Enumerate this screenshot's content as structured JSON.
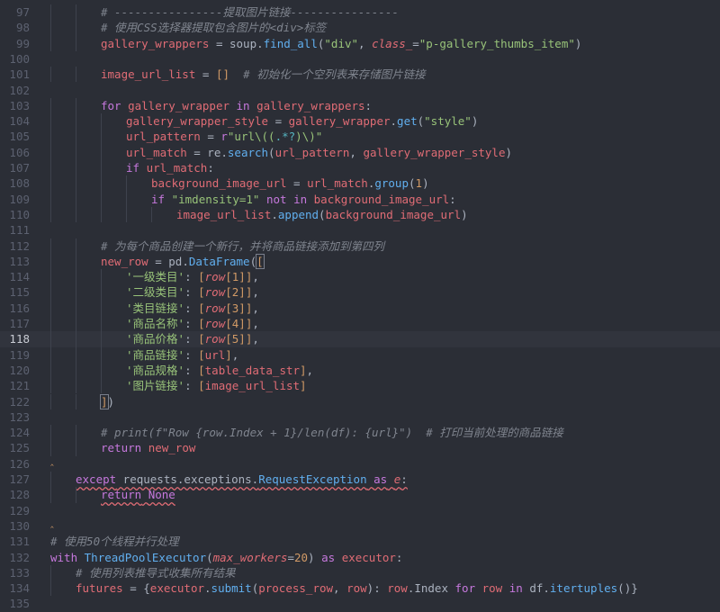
{
  "colors": {
    "background": "#2b2e36",
    "active_line": "#31343d",
    "keyword": "#c678dd",
    "builtin": "#61afef",
    "string": "#98c379",
    "param": "#e06c75",
    "number": "#d19a66",
    "comment": "#7f848e",
    "text": "#abb2bf",
    "escape": "#56b6c2"
  },
  "active_line": 118,
  "lines": [
    {
      "n": "97",
      "indent": 2,
      "segs": [
        [
          "c",
          "# ----------------提取图片链接----------------"
        ]
      ]
    },
    {
      "n": "98",
      "indent": 2,
      "segs": [
        [
          "c",
          "# 使用CSS选择器提取包含图片的<div>标签"
        ]
      ]
    },
    {
      "n": "99",
      "indent": 2,
      "segs": [
        [
          "v",
          "gallery_wrappers"
        ],
        [
          "t",
          " = soup."
        ],
        [
          "f",
          "find_all"
        ],
        [
          "t",
          "("
        ],
        [
          "s",
          "\"div\""
        ],
        [
          "t",
          ", "
        ],
        [
          "pi",
          "class_"
        ],
        [
          "t",
          "="
        ],
        [
          "s",
          "\"p-gallery_thumbs_item\""
        ],
        [
          "t",
          ")"
        ]
      ]
    },
    {
      "n": "100",
      "indent": 0,
      "segs": []
    },
    {
      "n": "101",
      "indent": 2,
      "segs": [
        [
          "v",
          "image_url_list"
        ],
        [
          "t",
          " = "
        ],
        [
          "y",
          "[]"
        ],
        [
          "t",
          "  "
        ],
        [
          "c",
          "# 初始化一个空列表来存储图片链接"
        ]
      ]
    },
    {
      "n": "102",
      "indent": 0,
      "segs": []
    },
    {
      "n": "103",
      "indent": 2,
      "segs": [
        [
          "k",
          "for"
        ],
        [
          "t",
          " "
        ],
        [
          "v",
          "gallery_wrapper"
        ],
        [
          "t",
          " "
        ],
        [
          "k",
          "in"
        ],
        [
          "t",
          " "
        ],
        [
          "v",
          "gallery_wrappers"
        ],
        [
          "t",
          ":"
        ]
      ]
    },
    {
      "n": "104",
      "indent": 3,
      "segs": [
        [
          "v",
          "gallery_wrapper_style"
        ],
        [
          "t",
          " = "
        ],
        [
          "v",
          "gallery_wrapper"
        ],
        [
          "t",
          "."
        ],
        [
          "f",
          "get"
        ],
        [
          "t",
          "("
        ],
        [
          "s",
          "\"style\""
        ],
        [
          "t",
          ")"
        ]
      ]
    },
    {
      "n": "105",
      "indent": 3,
      "segs": [
        [
          "v",
          "url_pattern"
        ],
        [
          "t",
          " = "
        ],
        [
          "k",
          "r"
        ],
        [
          "s",
          "\"url\\(("
        ],
        [
          "e",
          ".*?"
        ],
        [
          "s",
          ")\\)\""
        ]
      ]
    },
    {
      "n": "106",
      "indent": 3,
      "segs": [
        [
          "v",
          "url_match"
        ],
        [
          "t",
          " = re."
        ],
        [
          "f",
          "search"
        ],
        [
          "t",
          "("
        ],
        [
          "v",
          "url_pattern"
        ],
        [
          "t",
          ", "
        ],
        [
          "v",
          "gallery_wrapper_style"
        ],
        [
          "t",
          ")"
        ]
      ]
    },
    {
      "n": "107",
      "indent": 3,
      "segs": [
        [
          "k",
          "if"
        ],
        [
          "t",
          " "
        ],
        [
          "v",
          "url_match"
        ],
        [
          "t",
          ":"
        ]
      ]
    },
    {
      "n": "108",
      "indent": 4,
      "segs": [
        [
          "v",
          "background_image_url"
        ],
        [
          "t",
          " = "
        ],
        [
          "v",
          "url_match"
        ],
        [
          "t",
          "."
        ],
        [
          "f",
          "group"
        ],
        [
          "t",
          "("
        ],
        [
          "n",
          "1"
        ],
        [
          "t",
          ")"
        ]
      ]
    },
    {
      "n": "109",
      "indent": 4,
      "segs": [
        [
          "k",
          "if"
        ],
        [
          "t",
          " "
        ],
        [
          "s",
          "\"imdensity=1\""
        ],
        [
          "t",
          " "
        ],
        [
          "k",
          "not in"
        ],
        [
          "t",
          " "
        ],
        [
          "v",
          "background_image_url"
        ],
        [
          "t",
          ":"
        ]
      ]
    },
    {
      "n": "110",
      "indent": 5,
      "segs": [
        [
          "v",
          "image_url_list"
        ],
        [
          "t",
          "."
        ],
        [
          "f",
          "append"
        ],
        [
          "t",
          "("
        ],
        [
          "v",
          "background_image_url"
        ],
        [
          "t",
          ")"
        ]
      ]
    },
    {
      "n": "111",
      "indent": 0,
      "segs": []
    },
    {
      "n": "112",
      "indent": 2,
      "segs": [
        [
          "c",
          "# 为每个商品创建一个新行，并将商品链接添加到第四列"
        ]
      ]
    },
    {
      "n": "113",
      "indent": 2,
      "segs": [
        [
          "v",
          "new_row"
        ],
        [
          "t",
          " = pd."
        ],
        [
          "f",
          "DataFrame"
        ],
        [
          "t",
          "("
        ],
        [
          "y",
          "["
        ]
      ]
    },
    {
      "n": "114",
      "indent": 3,
      "segs": [
        [
          "s",
          "'一级类目'"
        ],
        [
          "t",
          ": "
        ],
        [
          "y",
          "["
        ],
        [
          "pi",
          "row"
        ],
        [
          "y",
          "["
        ],
        [
          "n",
          "1"
        ],
        [
          "y",
          "]]"
        ],
        [
          "t",
          ","
        ]
      ]
    },
    {
      "n": "115",
      "indent": 3,
      "segs": [
        [
          "s",
          "'二级类目'"
        ],
        [
          "t",
          ": "
        ],
        [
          "y",
          "["
        ],
        [
          "pi",
          "row"
        ],
        [
          "y",
          "["
        ],
        [
          "n",
          "2"
        ],
        [
          "y",
          "]]"
        ],
        [
          "t",
          ","
        ]
      ]
    },
    {
      "n": "116",
      "indent": 3,
      "segs": [
        [
          "s",
          "'类目链接'"
        ],
        [
          "t",
          ": "
        ],
        [
          "y",
          "["
        ],
        [
          "pi",
          "row"
        ],
        [
          "y",
          "["
        ],
        [
          "n",
          "3"
        ],
        [
          "y",
          "]]"
        ],
        [
          "t",
          ","
        ]
      ]
    },
    {
      "n": "117",
      "indent": 3,
      "segs": [
        [
          "s",
          "'商品名称'"
        ],
        [
          "t",
          ": "
        ],
        [
          "y",
          "["
        ],
        [
          "pi",
          "row"
        ],
        [
          "y",
          "["
        ],
        [
          "n",
          "4"
        ],
        [
          "y",
          "]]"
        ],
        [
          "t",
          ","
        ]
      ]
    },
    {
      "n": "118",
      "indent": 3,
      "segs": [
        [
          "s",
          "'商品价格'"
        ],
        [
          "t",
          ": "
        ],
        [
          "y",
          "["
        ],
        [
          "pi",
          "row"
        ],
        [
          "y",
          "["
        ],
        [
          "n",
          "5"
        ],
        [
          "y",
          "]]"
        ],
        [
          "t",
          ","
        ]
      ]
    },
    {
      "n": "119",
      "indent": 3,
      "segs": [
        [
          "s",
          "'商品链接'"
        ],
        [
          "t",
          ": "
        ],
        [
          "y",
          "["
        ],
        [
          "v",
          "url"
        ],
        [
          "y",
          "]"
        ],
        [
          "t",
          ","
        ]
      ]
    },
    {
      "n": "120",
      "indent": 3,
      "segs": [
        [
          "s",
          "'商品规格'"
        ],
        [
          "t",
          ": "
        ],
        [
          "y",
          "["
        ],
        [
          "v",
          "table_data_str"
        ],
        [
          "y",
          "]"
        ],
        [
          "t",
          ","
        ]
      ]
    },
    {
      "n": "121",
      "indent": 3,
      "segs": [
        [
          "s",
          "'图片链接'"
        ],
        [
          "t",
          ": "
        ],
        [
          "y",
          "["
        ],
        [
          "v",
          "image_url_list"
        ],
        [
          "y",
          "]"
        ]
      ]
    },
    {
      "n": "122",
      "indent": 2,
      "segs": [
        [
          "y",
          "]"
        ],
        [
          "t",
          ")"
        ]
      ]
    },
    {
      "n": "123",
      "indent": 0,
      "segs": []
    },
    {
      "n": "124",
      "indent": 2,
      "segs": [
        [
          "c",
          "# print(f\"Row {row.Index + 1}/len(df): {url}\")  # 打印当前处理的商品链接"
        ]
      ]
    },
    {
      "n": "125",
      "indent": 2,
      "segs": [
        [
          "k",
          "return"
        ],
        [
          "t",
          " "
        ],
        [
          "v",
          "new_row"
        ]
      ]
    },
    {
      "n": "126",
      "indent": 0,
      "fold": true,
      "segs": []
    },
    {
      "n": "127",
      "indent": 1,
      "squig": true,
      "segs": [
        [
          "k",
          "except"
        ],
        [
          "t",
          " requests.exceptions."
        ],
        [
          "f",
          "RequestException"
        ],
        [
          "t",
          " "
        ],
        [
          "k",
          "as"
        ],
        [
          "t",
          " "
        ],
        [
          "pi",
          "e"
        ],
        [
          "t",
          ":"
        ]
      ]
    },
    {
      "n": "128",
      "indent": 2,
      "squig": true,
      "segs": [
        [
          "k",
          "return"
        ],
        [
          "t",
          " "
        ],
        [
          "k",
          "None"
        ]
      ]
    },
    {
      "n": "129",
      "indent": 0,
      "segs": []
    },
    {
      "n": "130",
      "indent": 0,
      "fold": true,
      "segs": []
    },
    {
      "n": "131",
      "indent": 0,
      "segs": [
        [
          "c",
          "# 使用50个线程并行处理"
        ]
      ]
    },
    {
      "n": "132",
      "indent": 0,
      "segs": [
        [
          "k",
          "with"
        ],
        [
          "t",
          " "
        ],
        [
          "f",
          "ThreadPoolExecutor"
        ],
        [
          "t",
          "("
        ],
        [
          "pi",
          "max_workers"
        ],
        [
          "t",
          "="
        ],
        [
          "n",
          "20"
        ],
        [
          "t",
          ") "
        ],
        [
          "k",
          "as"
        ],
        [
          "t",
          " "
        ],
        [
          "v",
          "executor"
        ],
        [
          "t",
          ":"
        ]
      ]
    },
    {
      "n": "133",
      "indent": 1,
      "segs": [
        [
          "c",
          "# 使用列表推导式收集所有结果"
        ]
      ]
    },
    {
      "n": "134",
      "indent": 1,
      "segs": [
        [
          "v",
          "futures"
        ],
        [
          "t",
          " = {"
        ],
        [
          "v",
          "executor"
        ],
        [
          "t",
          "."
        ],
        [
          "f",
          "submit"
        ],
        [
          "t",
          "("
        ],
        [
          "v",
          "process_row"
        ],
        [
          "t",
          ", "
        ],
        [
          "v",
          "row"
        ],
        [
          "t",
          "): "
        ],
        [
          "v",
          "row"
        ],
        [
          "t",
          ".Index "
        ],
        [
          "k",
          "for"
        ],
        [
          "t",
          " "
        ],
        [
          "v",
          "row"
        ],
        [
          "t",
          " "
        ],
        [
          "k",
          "in"
        ],
        [
          "t",
          " df."
        ],
        [
          "f",
          "itertuples"
        ],
        [
          "t",
          "()}"
        ]
      ]
    },
    {
      "n": "135",
      "indent": 0,
      "segs": []
    }
  ]
}
